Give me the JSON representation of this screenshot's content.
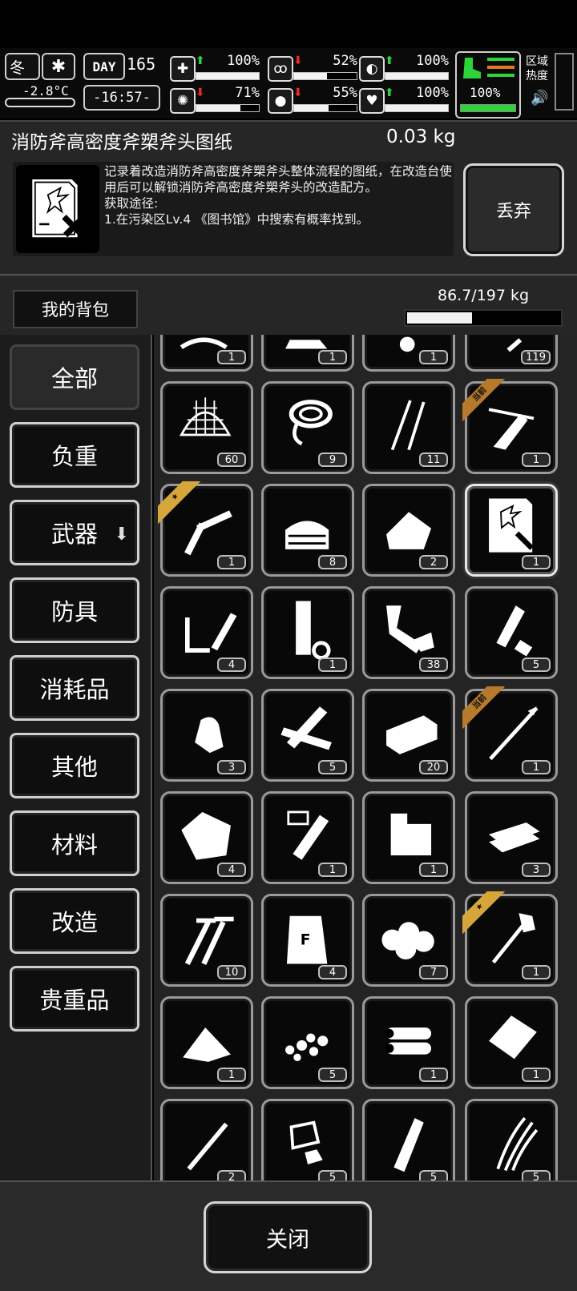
{
  "hud": {
    "season": "冬",
    "day_label": "DAY",
    "day": "165",
    "temperature": "-2.8°C",
    "time": "-16:57-",
    "region_heat": "区域\n热度",
    "stats": [
      {
        "name": "health",
        "arrow": "up",
        "value": "100%",
        "level": 1.0
      },
      {
        "name": "hunger",
        "arrow": "down",
        "value": "52%",
        "level": 0.52
      },
      {
        "name": "defense",
        "arrow": "up",
        "value": "100%",
        "level": 1.0
      },
      {
        "name": "mental",
        "arrow": "down",
        "value": "71%",
        "level": 0.71
      },
      {
        "name": "thirst",
        "arrow": "down",
        "value": "55%",
        "level": 0.55
      },
      {
        "name": "heart",
        "arrow": "up",
        "value": "100%",
        "level": 1.0
      }
    ],
    "stamina": "100%",
    "stamina_level": 1.0,
    "stamina_color": "#2fd33a"
  },
  "item_detail": {
    "name": "消防斧高密度斧槊斧头图纸",
    "weight": "0.03 kg",
    "description": "记录着改造消防斧高密度斧槊斧头整体流程的图纸，在改造台使用后可以解锁消防斧高密度斧槊斧头的改造配方。\n获取途径:\n1.在污染区Lv.4 《图书馆》中搜索有概率找到。",
    "discard_label": "丢弃"
  },
  "backpack": {
    "title": "我的背包",
    "weight": "86.7/197 kg",
    "fill": 0.44
  },
  "categories": [
    {
      "label": "全部",
      "active": true
    },
    {
      "label": "负重"
    },
    {
      "label": "武器",
      "dropdown": true
    },
    {
      "label": "防具"
    },
    {
      "label": "消耗品"
    },
    {
      "label": "其他"
    },
    {
      "label": "材料"
    },
    {
      "label": "改造"
    },
    {
      "label": "贵重品"
    }
  ],
  "tag_equipped": "当前",
  "items": [
    {
      "icon": "misc-icon",
      "qty": "1"
    },
    {
      "icon": "cloth-icon",
      "qty": "1"
    },
    {
      "icon": "parts-icon",
      "qty": "1"
    },
    {
      "icon": "feather-icon",
      "qty": "119"
    },
    {
      "icon": "net-icon",
      "qty": "60"
    },
    {
      "icon": "rope-icon",
      "qty": "9"
    },
    {
      "icon": "lockpick-icon",
      "qty": "11"
    },
    {
      "icon": "crossbow-icon",
      "qty": "1",
      "tag": "equip"
    },
    {
      "icon": "caliper-knife-icon",
      "qty": "1",
      "tag": "star"
    },
    {
      "icon": "fabric-icon",
      "qty": "8"
    },
    {
      "icon": "leather-icon",
      "qty": "2"
    },
    {
      "icon": "blueprint-icon",
      "qty": "1",
      "selected": true
    },
    {
      "icon": "soldering-iron-icon",
      "qty": "4"
    },
    {
      "icon": "pipe-icon",
      "qty": "1"
    },
    {
      "icon": "scrap-metal-icon",
      "qty": "38"
    },
    {
      "icon": "plastic-bottle-icon",
      "qty": "5"
    },
    {
      "icon": "stone-icon",
      "qty": "3"
    },
    {
      "icon": "planks-icon",
      "qty": "5"
    },
    {
      "icon": "brick-icon",
      "qty": "20"
    },
    {
      "icon": "spear-icon",
      "qty": "1",
      "tag": "equip"
    },
    {
      "icon": "ore-icon",
      "qty": "4"
    },
    {
      "icon": "test-tube-icon",
      "qty": "1"
    },
    {
      "icon": "wood-block-icon",
      "qty": "1"
    },
    {
      "icon": "tiles-icon",
      "qty": "3"
    },
    {
      "icon": "screws-icon",
      "qty": "10"
    },
    {
      "icon": "flour-bag-icon",
      "qty": "4"
    },
    {
      "icon": "cotton-icon",
      "qty": "7"
    },
    {
      "icon": "shovel-icon",
      "qty": "1",
      "tag": "star"
    },
    {
      "icon": "powder-icon",
      "qty": "1"
    },
    {
      "icon": "gravel-icon",
      "qty": "5"
    },
    {
      "icon": "logs-icon",
      "qty": "1"
    },
    {
      "icon": "package-icon",
      "qty": "1"
    },
    {
      "icon": "syringe-icon",
      "qty": "2"
    },
    {
      "icon": "glass-shards-icon",
      "qty": "5"
    },
    {
      "icon": "bottle-icon",
      "qty": "5"
    },
    {
      "icon": "wires-icon",
      "qty": "5"
    }
  ],
  "close_label": "关闭"
}
